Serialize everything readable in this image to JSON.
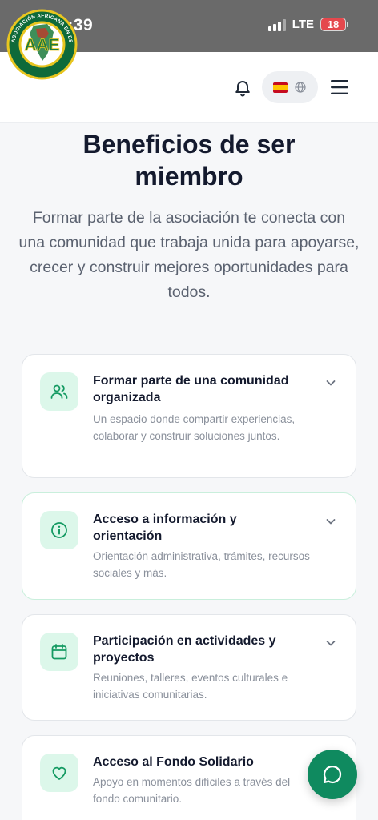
{
  "status_bar": {
    "time": "13:39",
    "network": "LTE",
    "battery": "18"
  },
  "header": {
    "logo_text": "ASOCIACIÓN AFRICANA EN ESPAÑA",
    "logo_short": "AAE",
    "language_flag": "Spain",
    "brand_color": "#0f8a5f"
  },
  "hero": {
    "title": "Beneficios de ser miembro",
    "subtitle": "Formar parte de la asociación te conecta con una comunidad que trabaja unida para apoyarse, crecer y construir mejores oportunidades para todos."
  },
  "benefits": [
    {
      "icon": "users-icon",
      "title": "Formar parte de una comunidad organizada",
      "description": "Un espacio donde compartir experiencias, colaborar y construir soluciones juntos."
    },
    {
      "icon": "info-icon",
      "title": "Acceso a información y orientación",
      "description": "Orientación administrativa, trámites, recursos sociales y más."
    },
    {
      "icon": "calendar-icon",
      "title": "Participación en actividades y proyectos",
      "description": "Reuniones, talleres, eventos culturales e iniciativas comunitarias."
    },
    {
      "icon": "heart-icon",
      "title": "Acceso al Fondo Solidario",
      "description": "Apoyo en momentos difíciles a través del fondo comunitario."
    }
  ]
}
